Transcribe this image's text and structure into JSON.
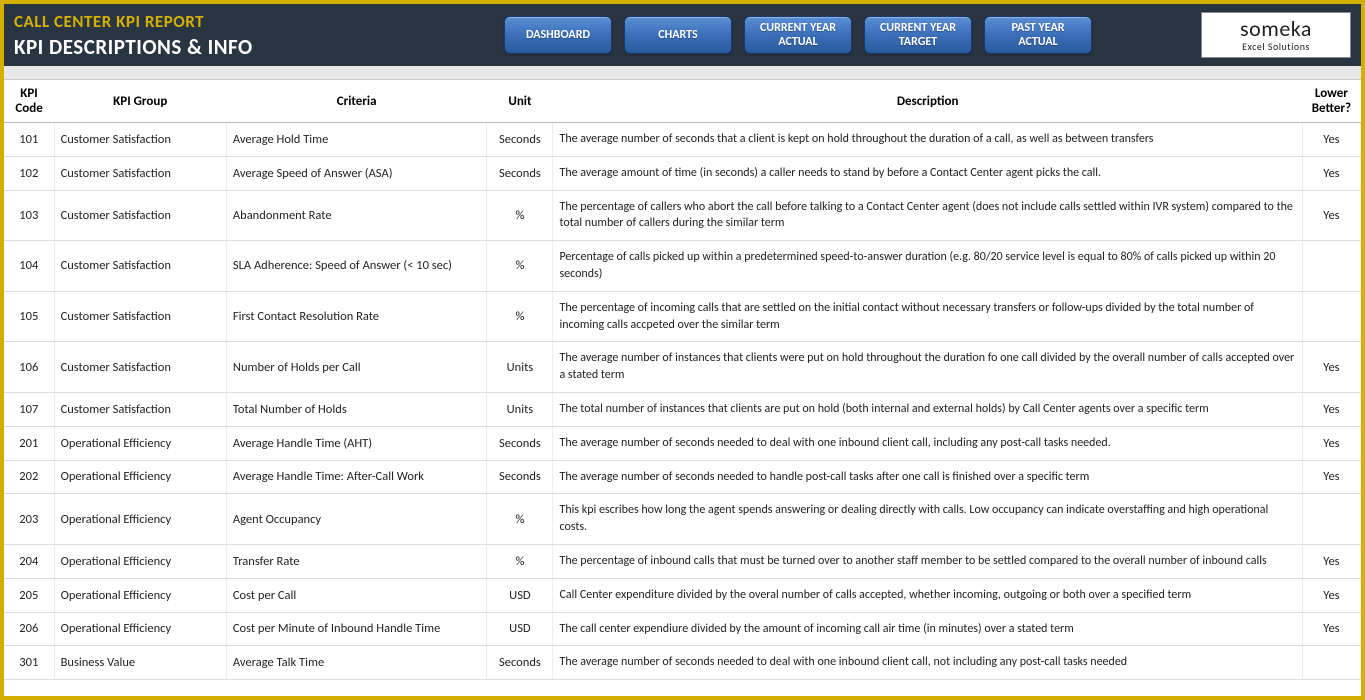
{
  "header": {
    "title": "CALL CENTER KPI REPORT",
    "subtitle": "KPI DESCRIPTIONS & INFO",
    "nav": [
      "DASHBOARD",
      "CHARTS",
      "CURRENT YEAR\nACTUAL",
      "CURRENT YEAR\nTARGET",
      "PAST YEAR\nACTUAL"
    ],
    "logo_main": "someka",
    "logo_sub": "Excel Solutions"
  },
  "table": {
    "headers": {
      "code": "KPI Code",
      "group": "KPI Group",
      "criteria": "Criteria",
      "unit": "Unit",
      "desc": "Description",
      "lower": "Lower Better?"
    },
    "rows": [
      {
        "code": "101",
        "group": "Customer Satisfaction",
        "criteria": "Average Hold Time",
        "unit": "Seconds",
        "desc": "The average number of seconds that a client is kept on hold throughout the duration of a call, as well as between transfers",
        "lower": "Yes"
      },
      {
        "code": "102",
        "group": "Customer Satisfaction",
        "criteria": "Average Speed of Answer (ASA)",
        "unit": "Seconds",
        "desc": "The average amount of time (in seconds) a caller needs to stand by before a Contact Center agent picks the call.",
        "lower": "Yes"
      },
      {
        "code": "103",
        "group": "Customer Satisfaction",
        "criteria": "Abandonment Rate",
        "unit": "%",
        "desc": "The percentage of callers who abort the call before talking to a Contact Center agent (does not include calls settled within IVR system) compared to the total number of callers during the similar term",
        "lower": "Yes"
      },
      {
        "code": "104",
        "group": "Customer Satisfaction",
        "criteria": "SLA Adherence: Speed of Answer (< 10 sec)",
        "unit": "%",
        "desc": "Percentage of calls picked up within a predetermined speed-to-answer duration (e.g. 80/20 service level is equal to 80% of calls picked up within 20 seconds)",
        "lower": ""
      },
      {
        "code": "105",
        "group": "Customer Satisfaction",
        "criteria": "First Contact Resolution Rate",
        "unit": "%",
        "desc": "The percentage of incoming calls that are settled on the initial contact without necessary transfers or follow-ups divided by the total number of incoming calls accpeted over the similar term",
        "lower": ""
      },
      {
        "code": "106",
        "group": "Customer Satisfaction",
        "criteria": "Number of Holds per Call",
        "unit": "Units",
        "desc": "The average number of instances that clients were put on hold throughout the duration fo one call divided by the overall number of calls accepted over a stated term",
        "lower": "Yes"
      },
      {
        "code": "107",
        "group": "Customer Satisfaction",
        "criteria": "Total Number of Holds",
        "unit": "Units",
        "desc": "The total number of instances that clients are put on hold (both internal and external holds) by Call Center agents over a specific term",
        "lower": "Yes"
      },
      {
        "code": "201",
        "group": "Operational Efficiency",
        "criteria": "Average Handle Time (AHT)",
        "unit": "Seconds",
        "desc": "The average number of seconds needed to deal with one inbound client call, including any post-call tasks needed.",
        "lower": "Yes"
      },
      {
        "code": "202",
        "group": "Operational Efficiency",
        "criteria": "Average Handle Time: After-Call Work",
        "unit": "Seconds",
        "desc": "The average number of seconds needed to handle post-call tasks after one call is finished over a specific term",
        "lower": "Yes"
      },
      {
        "code": "203",
        "group": "Operational Efficiency",
        "criteria": "Agent Occupancy",
        "unit": "%",
        "desc": "This kpi escribes how long the agent spends answering or dealing directly with calls. Low occupancy can indicate overstaffing and high operational costs.",
        "lower": ""
      },
      {
        "code": "204",
        "group": "Operational Efficiency",
        "criteria": "Transfer Rate",
        "unit": "%",
        "desc": "The percentage of inbound calls that must be turned over to another staff member to be settled compared to the overall number of inbound calls",
        "lower": "Yes"
      },
      {
        "code": "205",
        "group": "Operational Efficiency",
        "criteria": "Cost per Call",
        "unit": "USD",
        "desc": "Call Center expenditure divided by the overal number of calls accepted, whether incoming, outgoing or both over a specified term",
        "lower": "Yes"
      },
      {
        "code": "206",
        "group": "Operational Efficiency",
        "criteria": "Cost per Minute of Inbound Handle Time",
        "unit": "USD",
        "desc": "The call center expendiure divided by the amount of incoming call air time (in minutes) over a stated term",
        "lower": "Yes"
      },
      {
        "code": "301",
        "group": "Business Value",
        "criteria": "Average Talk Time",
        "unit": "Seconds",
        "desc": "The average number of seconds needed to deal with one inbound client call, not including any post-call tasks needed",
        "lower": ""
      }
    ]
  }
}
